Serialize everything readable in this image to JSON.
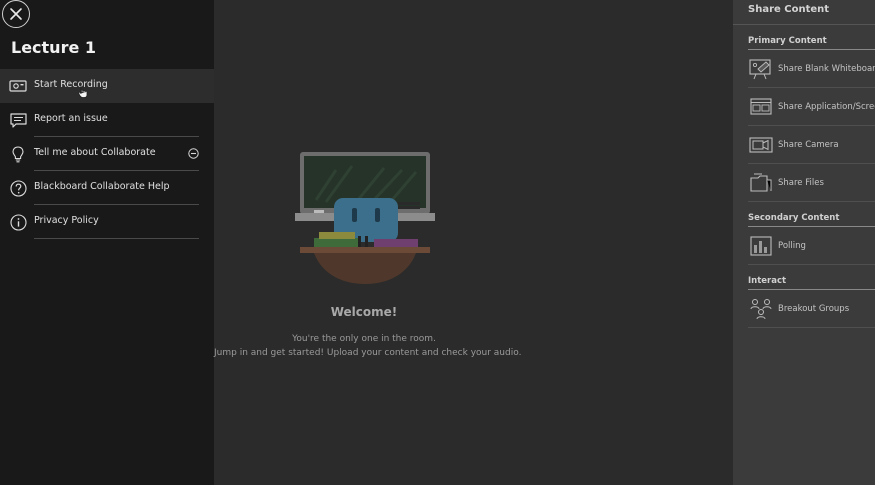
{
  "session": {
    "title": "Lecture 1"
  },
  "menu": {
    "items": [
      {
        "label": "Start Recording",
        "icon": "record-icon"
      },
      {
        "label": "Report an issue",
        "icon": "report-icon"
      },
      {
        "label": "Tell me about Collaborate",
        "icon": "lightbulb-icon"
      },
      {
        "label": "Blackboard Collaborate Help",
        "icon": "help-icon"
      },
      {
        "label": "Privacy Policy",
        "icon": "info-icon"
      }
    ]
  },
  "stage": {
    "welcome_title": "Welcome!",
    "welcome_line_1": "You're the only one in the room.",
    "welcome_line_2": "Jump in and get started! Upload your content and check your audio."
  },
  "share": {
    "title": "Share Content",
    "sections": {
      "primary": "Primary Content",
      "secondary": "Secondary Content",
      "interact": "Interact"
    },
    "items": {
      "whiteboard": "Share Blank Whiteboard",
      "application": "Share Application/Screen",
      "camera": "Share Camera",
      "files": "Share Files",
      "polling": "Polling",
      "breakout": "Breakout Groups"
    }
  },
  "colors": {
    "menu_background": "#191919",
    "stage_background": "#2b2b2b",
    "panel_background": "#3b3b3b"
  }
}
